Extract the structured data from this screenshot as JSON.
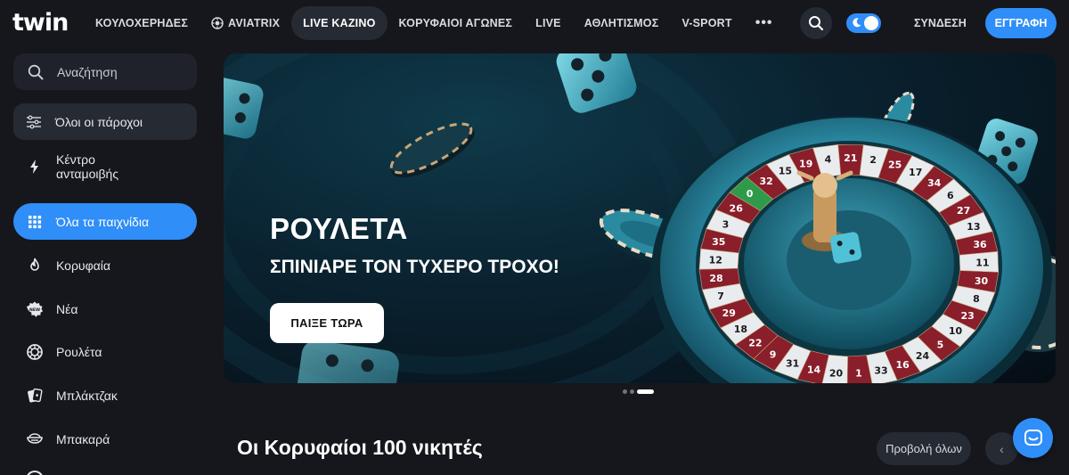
{
  "header": {
    "logo": "twin",
    "nav": [
      {
        "label": "ΚΟΥΛΟΧΕΡΗΔΕΣ"
      },
      {
        "label": "AVIATRIX",
        "icon": "aviatrix-chip-icon"
      },
      {
        "label": "LIVE ΚΑΖΙΝΟ",
        "active": true
      },
      {
        "label": "ΚΟΡΥΦΑΙΟΙ ΑΓΩΝΕΣ"
      },
      {
        "label": "LIVE"
      },
      {
        "label": "ΑΘΛΗΤΙΣΜΟΣ"
      },
      {
        "label": "V-SPORT"
      }
    ],
    "more": "•••",
    "login": "ΣΥΝΔΕΣΗ",
    "signup": "ΕΓΓΡΑΦΗ"
  },
  "sidebar": {
    "search": "Αναζήτηση",
    "providers": "Όλοι οι πάροχοι",
    "items": [
      {
        "label": "Κέντρο ανταμοιβής",
        "icon": "bolt-icon"
      },
      {
        "label": "Όλα τα παιχνίδια",
        "icon": "grid-icon",
        "active": true
      },
      {
        "label": "Κορυφαία",
        "icon": "flame-icon"
      },
      {
        "label": "Νέα",
        "icon": "new-badge-icon"
      },
      {
        "label": "Ρουλέτα",
        "icon": "roulette-icon"
      },
      {
        "label": "Μπλάκτζακ",
        "icon": "cards-icon"
      },
      {
        "label": "Μπακαρά",
        "icon": "baccarat-icon"
      }
    ]
  },
  "banner": {
    "title": "ΡΟΥΛΕΤΑ",
    "subtitle": "ΣΠΙΝΙΑΡΕ ΤΟΝ ΤΥΧΕΡΟ ΤΡΟΧΟ!",
    "cta": "ΠΑΙΞΕ ΤΩΡΑ",
    "wheel_numbers": [
      "22",
      "18",
      "29",
      "7",
      "28",
      "12",
      "35",
      "3",
      "26",
      "0",
      "32",
      "15",
      "19",
      "4",
      "21",
      "2",
      "25",
      "17",
      "34",
      "6",
      "27",
      "13",
      "36",
      "11",
      "30",
      "8",
      "23",
      "10",
      "5",
      "24",
      "16",
      "33",
      "1",
      "20",
      "14",
      "31",
      "9"
    ],
    "slides": 3,
    "active_slide": 3
  },
  "section": {
    "title": "Οι Κορυφαίοι 100 νικητές",
    "view_all": "Προβολή όλων",
    "prev": "‹"
  },
  "colors": {
    "accent": "#2f8ef7",
    "background": "#15171d",
    "surface": "#262a33"
  }
}
